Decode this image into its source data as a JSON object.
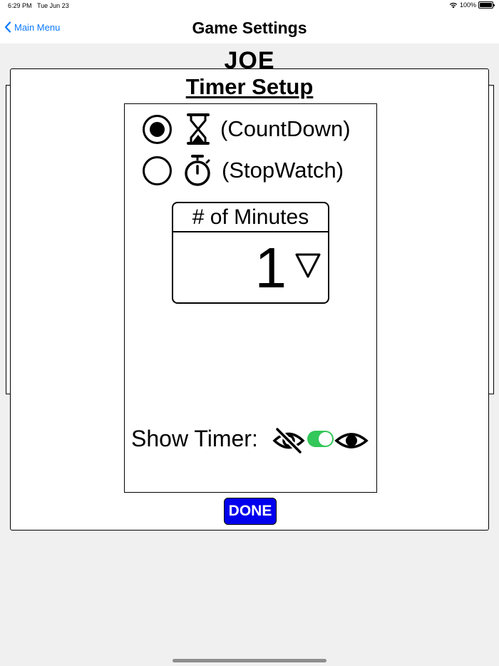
{
  "status_bar": {
    "time": "6:29 PM",
    "date": "Tue Jun 23",
    "battery": "100%"
  },
  "nav": {
    "back_label": "Main Menu",
    "title": "Game Settings"
  },
  "background": {
    "name": "JOE"
  },
  "modal": {
    "title": "Timer Setup",
    "modes": [
      {
        "label": "(CountDown)",
        "icon": "hourglass-icon",
        "selected": true
      },
      {
        "label": "(StopWatch)",
        "icon": "stopwatch-icon",
        "selected": false
      }
    ],
    "minutes_label": "# of Minutes",
    "minutes_value": "1",
    "show_timer_label": "Show Timer:",
    "show_timer_on": true,
    "done_label": "DONE"
  },
  "colors": {
    "accent": "#0a7aff",
    "toggle_on": "#34c759",
    "done_button": "#0000ee",
    "background": "#f0f0f0"
  }
}
